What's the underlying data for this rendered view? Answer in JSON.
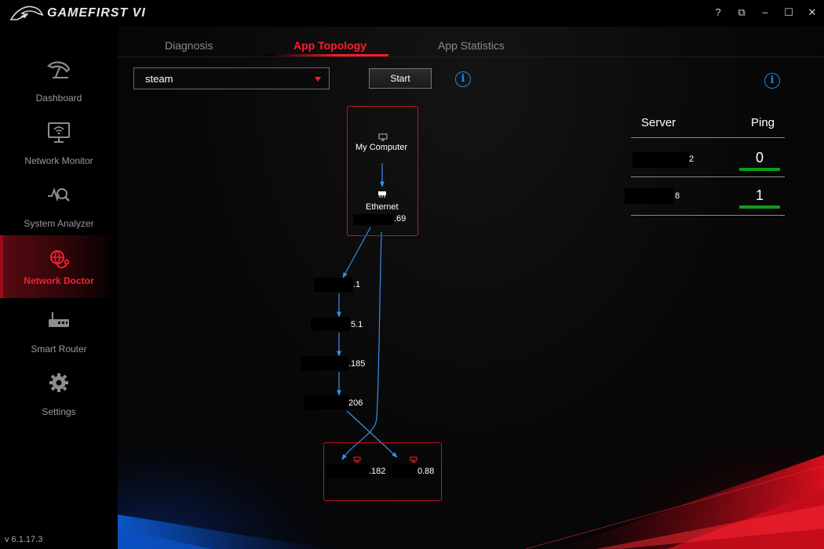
{
  "window": {
    "title": "GAMEFIRST VI",
    "controls": [
      "?",
      "⧉",
      "–",
      "☐",
      "✕"
    ]
  },
  "sidebar": {
    "items": [
      {
        "label": "Dashboard",
        "icon": "speedometer-icon"
      },
      {
        "label": "Network Monitor",
        "icon": "monitor-wifi-icon"
      },
      {
        "label": "System Analyzer",
        "icon": "analyzer-icon"
      },
      {
        "label": "Network Doctor",
        "icon": "globe-stethoscope-icon",
        "active": true
      },
      {
        "label": "Smart Router",
        "icon": "router-icon"
      },
      {
        "label": "Settings",
        "icon": "gear-icon"
      }
    ],
    "version": "v 6.1.17.3"
  },
  "tabs": [
    {
      "label": "Diagnosis"
    },
    {
      "label": "App Topology",
      "active": true
    },
    {
      "label": "App Statistics"
    }
  ],
  "app_select": {
    "value": "steam"
  },
  "start_button": {
    "label": "Start"
  },
  "info_icon": "i",
  "server_table": {
    "headers": {
      "server": "Server",
      "ping": "Ping"
    },
    "rows": [
      {
        "server": "2",
        "ping": "0"
      },
      {
        "server": "8",
        "ping": "1"
      }
    ]
  },
  "topology": {
    "my_computer": "My Computer",
    "ethernet": "Ethernet",
    "local_ip_suffix": ".69",
    "hops": [
      ".1",
      "5.1",
      ".185",
      "206"
    ],
    "destinations": [
      ".182",
      "0.88"
    ]
  },
  "colors": {
    "accent": "#ff1e2d",
    "link": "#1e88e5",
    "ping_good": "#0c9d1a",
    "box_border": "#c0141f"
  }
}
